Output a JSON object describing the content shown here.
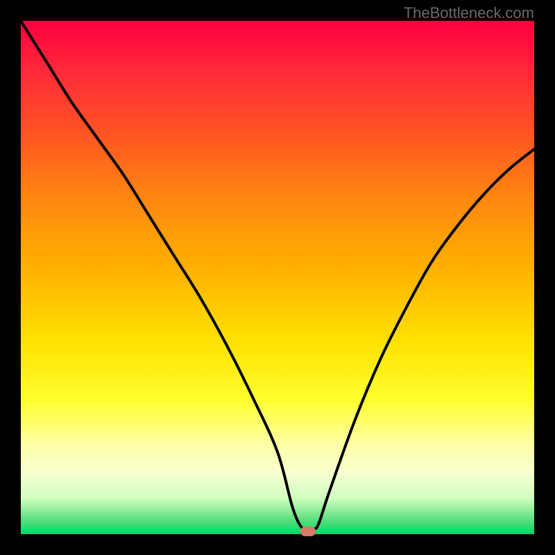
{
  "watermark": "TheBottleneck.com",
  "chart_data": {
    "type": "line",
    "title": "",
    "xlabel": "",
    "ylabel": "",
    "xlim": [
      0,
      100
    ],
    "ylim": [
      0,
      100
    ],
    "grid": false,
    "series": [
      {
        "name": "curve",
        "x": [
          0,
          5,
          10,
          15,
          20,
          25,
          30,
          35,
          40,
          45,
          50,
          53,
          55,
          57,
          58,
          60,
          65,
          70,
          75,
          80,
          85,
          90,
          95,
          100
        ],
        "values": [
          100,
          92,
          84,
          77,
          70,
          62,
          54,
          46,
          37,
          27,
          16,
          5,
          1,
          1,
          2,
          8,
          22,
          34,
          44,
          53,
          60,
          66,
          71,
          75
        ]
      }
    ],
    "marker": {
      "x": 56,
      "y": 0.5,
      "color": "#d87a6a"
    },
    "background_gradient": {
      "top": "#ff0040",
      "mid": "#ffe000",
      "bottom": "#00d868"
    }
  }
}
